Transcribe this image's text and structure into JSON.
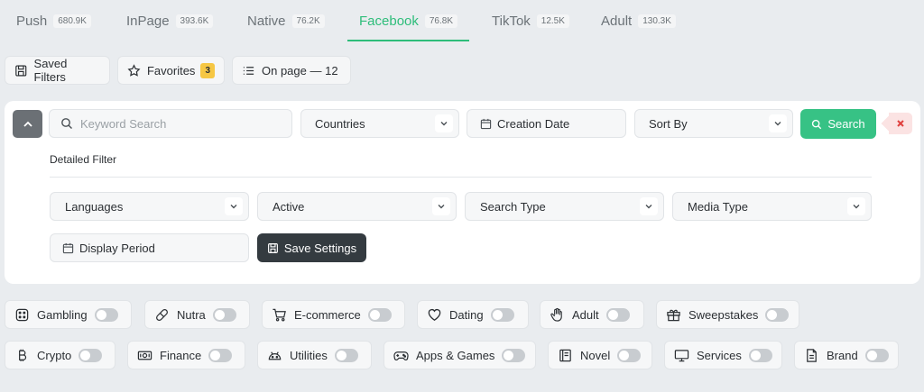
{
  "tabs": [
    {
      "label": "Push",
      "count": "680.9K"
    },
    {
      "label": "InPage",
      "count": "393.6K"
    },
    {
      "label": "Native",
      "count": "76.2K"
    },
    {
      "label": "Facebook",
      "count": "76.8K",
      "active": true
    },
    {
      "label": "TikTok",
      "count": "12.5K"
    },
    {
      "label": "Adult",
      "count": "130.3K"
    }
  ],
  "toolbar": {
    "saved_filters": "Saved Filters",
    "favorites": "Favorites",
    "favorites_count": "3",
    "on_page": "On page — 12"
  },
  "filters": {
    "keyword_placeholder": "Keyword Search",
    "countries": "Countries",
    "creation_date": "Creation Date",
    "sort_by": "Sort By",
    "search": "Search",
    "detailed_title": "Detailed Filter",
    "languages": "Languages",
    "active": "Active",
    "search_type": "Search Type",
    "media_type": "Media Type",
    "display_period": "Display Period",
    "save_settings": "Save Settings"
  },
  "categories": [
    {
      "label": "Gambling",
      "icon": "dice-icon"
    },
    {
      "label": "Nutra",
      "icon": "pill-icon"
    },
    {
      "label": "E-commerce",
      "icon": "cart-icon"
    },
    {
      "label": "Dating",
      "icon": "heart-icon"
    },
    {
      "label": "Adult",
      "icon": "hand-icon"
    },
    {
      "label": "Sweepstakes",
      "icon": "gift-icon"
    },
    {
      "label": "Crypto",
      "icon": "bitcoin-icon"
    },
    {
      "label": "Finance",
      "icon": "banknote-icon"
    },
    {
      "label": "Utilities",
      "icon": "android-icon"
    },
    {
      "label": "Apps & Games",
      "icon": "gamepad-icon"
    },
    {
      "label": "Novel",
      "icon": "book-icon"
    },
    {
      "label": "Services",
      "icon": "monitor-icon"
    },
    {
      "label": "Brand",
      "icon": "document-icon"
    }
  ],
  "colors": {
    "accent": "#2ebd7a",
    "search_button": "#37c285",
    "save_button": "#343b40",
    "badge": "#f6c744",
    "clear": "#e0413f"
  }
}
